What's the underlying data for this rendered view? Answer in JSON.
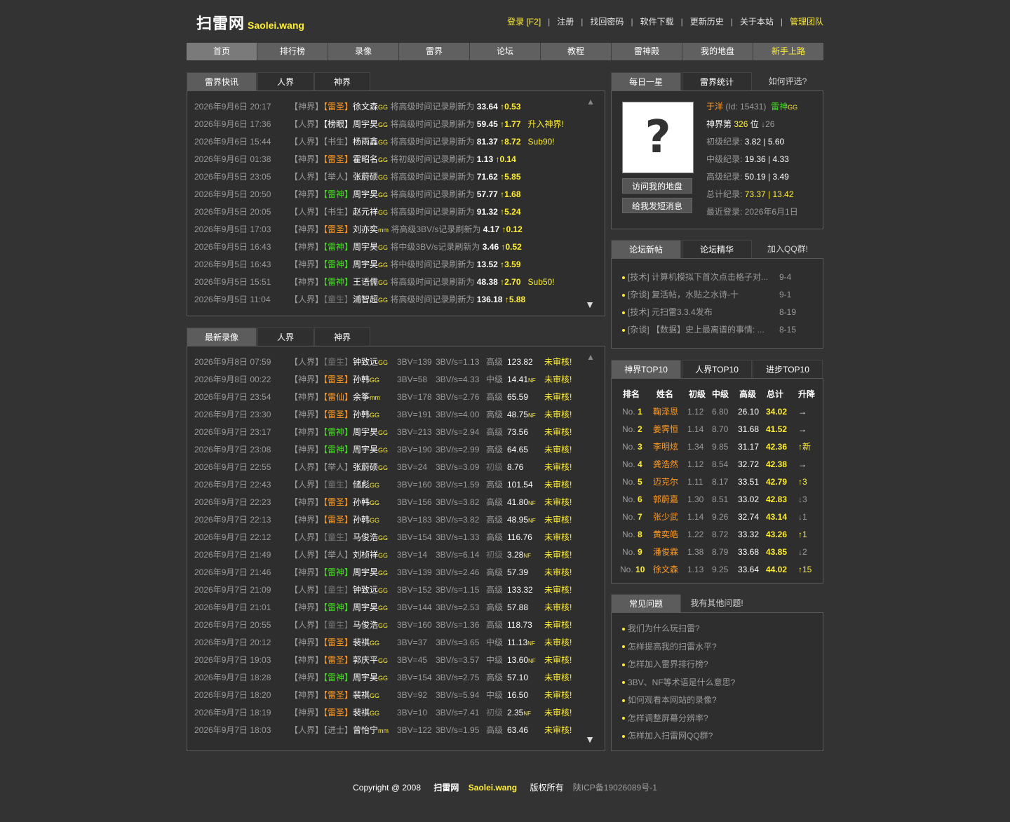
{
  "header": {
    "logo_cn": "扫雷网",
    "logo_en": "Saolei.wang",
    "links": [
      "登录 [F2]",
      "注册",
      "找回密码",
      "软件下载",
      "更新历史",
      "关于本站",
      "管理团队"
    ]
  },
  "nav": [
    "首页",
    "排行榜",
    "录像",
    "雷界",
    "论坛",
    "教程",
    "雷神殿",
    "我的地盘",
    "新手上路"
  ],
  "news": {
    "tabs": [
      "雷界快讯",
      "人界",
      "神界"
    ],
    "rows": [
      {
        "time": "2026年9月6日 20:17",
        "realm": "【神界】",
        "rank": "【雷圣】",
        "rankc": "or",
        "name": "徐文森",
        "suf": "GG",
        "msg": "将高级时间记录刷新为",
        "val": "33.64",
        "delta": "↑0.53",
        "extra": ""
      },
      {
        "time": "2026年9月6日 17:36",
        "realm": "【人界】",
        "rank": "【榜眼】",
        "rankc": "wh",
        "name": "周宇昊",
        "suf": "GG",
        "msg": "将高级时间记录刷新为",
        "val": "59.45",
        "delta": "↑1.77",
        "extra": "升入神界!"
      },
      {
        "time": "2026年9月6日 15:44",
        "realm": "【人界】",
        "rank": "【书生】",
        "rankc": "gr",
        "name": "杨雨鑫",
        "suf": "GG",
        "msg": "将高级时间记录刷新为",
        "val": "81.37",
        "delta": "↑8.72",
        "extra": "Sub90!"
      },
      {
        "time": "2026年9月6日 01:38",
        "realm": "【神界】",
        "rank": "【雷圣】",
        "rankc": "or",
        "name": "霍昭名",
        "suf": "GG",
        "msg": "将初级时间记录刷新为",
        "val": "1.13",
        "delta": "↑0.14",
        "extra": ""
      },
      {
        "time": "2026年9月5日 23:05",
        "realm": "【人界】",
        "rank": "【举人】",
        "rankc": "gr",
        "name": "张蔚硕",
        "suf": "GG",
        "msg": "将高级时间记录刷新为",
        "val": "71.62",
        "delta": "↑5.85",
        "extra": ""
      },
      {
        "time": "2026年9月5日 20:50",
        "realm": "【神界】",
        "rank": "【雷神】",
        "rankc": "gn",
        "name": "周宇昊",
        "suf": "GG",
        "msg": "将高级时间记录刷新为",
        "val": "57.77",
        "delta": "↑1.68",
        "extra": ""
      },
      {
        "time": "2026年9月5日 20:05",
        "realm": "【人界】",
        "rank": "【书生】",
        "rankc": "gr",
        "name": "赵元祥",
        "suf": "GG",
        "msg": "将高级时间记录刷新为",
        "val": "91.32",
        "delta": "↑5.24",
        "extra": ""
      },
      {
        "time": "2026年9月5日 17:03",
        "realm": "【神界】",
        "rank": "【雷圣】",
        "rankc": "or",
        "name": "刘亦奕",
        "suf": "mm",
        "msg": "将高级3BV/s记录刷新为",
        "val": "4.17",
        "delta": "↑0.12",
        "extra": ""
      },
      {
        "time": "2026年9月5日 16:43",
        "realm": "【神界】",
        "rank": "【雷神】",
        "rankc": "gn",
        "name": "周宇昊",
        "suf": "GG",
        "msg": "将中级3BV/s记录刷新为",
        "val": "3.46",
        "delta": "↑0.52",
        "extra": ""
      },
      {
        "time": "2026年9月5日 16:43",
        "realm": "【神界】",
        "rank": "【雷神】",
        "rankc": "gn",
        "name": "周宇昊",
        "suf": "GG",
        "msg": "将中级时间记录刷新为",
        "val": "13.52",
        "delta": "↑3.59",
        "extra": ""
      },
      {
        "time": "2026年9月5日 15:51",
        "realm": "【神界】",
        "rank": "【雷神】",
        "rankc": "gn",
        "name": "王语儒",
        "suf": "GG",
        "msg": "将高级时间记录刷新为",
        "val": "48.38",
        "delta": "↑2.70",
        "extra": "Sub50!"
      },
      {
        "time": "2026年9月5日 11:04",
        "realm": "【人界】",
        "rank": "【童生】",
        "rankc": "dg",
        "name": "浦智超",
        "suf": "GG",
        "msg": "将高级时间记录刷新为",
        "val": "136.18",
        "delta": "↑5.88",
        "extra": ""
      }
    ]
  },
  "videos": {
    "tabs": [
      "最新录像",
      "人界",
      "神界"
    ],
    "rows": [
      {
        "time": "2026年9月8日 07:59",
        "realm": "【人界】",
        "rank": "【童生】",
        "rankc": "dg",
        "name": "钟致远",
        "suf": "GG",
        "bv": "3BV=139",
        "bvs": "3BV/s=1.13",
        "lv": "高级",
        "val": "123.82",
        "nf": "",
        "status": "未审核!"
      },
      {
        "time": "2026年9月8日 00:22",
        "realm": "【神界】",
        "rank": "【雷圣】",
        "rankc": "or",
        "name": "孙韩",
        "suf": "GG",
        "bv": "3BV=58",
        "bvs": "3BV/s=4.33",
        "lv": "中级",
        "val": "14.41",
        "nf": "NF",
        "status": "未审核!"
      },
      {
        "time": "2026年9月7日 23:54",
        "realm": "【神界】",
        "rank": "【雷仙】",
        "rankc": "or",
        "name": "余筝",
        "suf": "mm",
        "bv": "3BV=178",
        "bvs": "3BV/s=2.76",
        "lv": "高级",
        "val": "65.59",
        "nf": "",
        "status": "未审核!"
      },
      {
        "time": "2026年9月7日 23:30",
        "realm": "【神界】",
        "rank": "【雷圣】",
        "rankc": "or",
        "name": "孙韩",
        "suf": "GG",
        "bv": "3BV=191",
        "bvs": "3BV/s=4.00",
        "lv": "高级",
        "val": "48.75",
        "nf": "NF",
        "status": "未审核!"
      },
      {
        "time": "2026年9月7日 23:17",
        "realm": "【神界】",
        "rank": "【雷神】",
        "rankc": "gn",
        "name": "周宇昊",
        "suf": "GG",
        "bv": "3BV=213",
        "bvs": "3BV/s=2.94",
        "lv": "高级",
        "val": "73.56",
        "nf": "",
        "status": "未审核!"
      },
      {
        "time": "2026年9月7日 23:08",
        "realm": "【神界】",
        "rank": "【雷神】",
        "rankc": "gn",
        "name": "周宇昊",
        "suf": "GG",
        "bv": "3BV=190",
        "bvs": "3BV/s=2.99",
        "lv": "高级",
        "val": "64.65",
        "nf": "",
        "status": "未审核!"
      },
      {
        "time": "2026年9月7日 22:55",
        "realm": "【人界】",
        "rank": "【举人】",
        "rankc": "gr",
        "name": "张蔚硕",
        "suf": "GG",
        "bv": "3BV=24",
        "bvs": "3BV/s=3.09",
        "lv": "初级",
        "val": "8.76",
        "nf": "",
        "status": "未审核!"
      },
      {
        "time": "2026年9月7日 22:43",
        "realm": "【人界】",
        "rank": "【童生】",
        "rankc": "dg",
        "name": "储彪",
        "suf": "GG",
        "bv": "3BV=160",
        "bvs": "3BV/s=1.59",
        "lv": "高级",
        "val": "101.54",
        "nf": "",
        "status": "未审核!"
      },
      {
        "time": "2026年9月7日 22:23",
        "realm": "【神界】",
        "rank": "【雷圣】",
        "rankc": "or",
        "name": "孙韩",
        "suf": "GG",
        "bv": "3BV=156",
        "bvs": "3BV/s=3.82",
        "lv": "高级",
        "val": "41.80",
        "nf": "NF",
        "status": "未审核!"
      },
      {
        "time": "2026年9月7日 22:13",
        "realm": "【神界】",
        "rank": "【雷圣】",
        "rankc": "or",
        "name": "孙韩",
        "suf": "GG",
        "bv": "3BV=183",
        "bvs": "3BV/s=3.82",
        "lv": "高级",
        "val": "48.95",
        "nf": "NF",
        "status": "未审核!"
      },
      {
        "time": "2026年9月7日 22:12",
        "realm": "【人界】",
        "rank": "【童生】",
        "rankc": "dg",
        "name": "马俊浩",
        "suf": "GG",
        "bv": "3BV=154",
        "bvs": "3BV/s=1.33",
        "lv": "高级",
        "val": "116.76",
        "nf": "",
        "status": "未审核!"
      },
      {
        "time": "2026年9月7日 21:49",
        "realm": "【人界】",
        "rank": "【举人】",
        "rankc": "gr",
        "name": "刘桢祥",
        "suf": "GG",
        "bv": "3BV=14",
        "bvs": "3BV/s=6.14",
        "lv": "初级",
        "val": "3.28",
        "nf": "NF",
        "status": "未审核!"
      },
      {
        "time": "2026年9月7日 21:46",
        "realm": "【神界】",
        "rank": "【雷神】",
        "rankc": "gn",
        "name": "周宇昊",
        "suf": "GG",
        "bv": "3BV=139",
        "bvs": "3BV/s=2.46",
        "lv": "高级",
        "val": "57.39",
        "nf": "",
        "status": "未审核!"
      },
      {
        "time": "2026年9月7日 21:09",
        "realm": "【人界】",
        "rank": "【童生】",
        "rankc": "dg",
        "name": "钟致远",
        "suf": "GG",
        "bv": "3BV=152",
        "bvs": "3BV/s=1.15",
        "lv": "高级",
        "val": "133.32",
        "nf": "",
        "status": "未审核!"
      },
      {
        "time": "2026年9月7日 21:01",
        "realm": "【神界】",
        "rank": "【雷神】",
        "rankc": "gn",
        "name": "周宇昊",
        "suf": "GG",
        "bv": "3BV=144",
        "bvs": "3BV/s=2.53",
        "lv": "高级",
        "val": "57.88",
        "nf": "",
        "status": "未审核!"
      },
      {
        "time": "2026年9月7日 20:55",
        "realm": "【人界】",
        "rank": "【童生】",
        "rankc": "dg",
        "name": "马俊浩",
        "suf": "GG",
        "bv": "3BV=160",
        "bvs": "3BV/s=1.36",
        "lv": "高级",
        "val": "118.73",
        "nf": "",
        "status": "未审核!"
      },
      {
        "time": "2026年9月7日 20:12",
        "realm": "【神界】",
        "rank": "【雷圣】",
        "rankc": "or",
        "name": "裴祺",
        "suf": "GG",
        "bv": "3BV=37",
        "bvs": "3BV/s=3.65",
        "lv": "中级",
        "val": "11.13",
        "nf": "NF",
        "status": "未审核!"
      },
      {
        "time": "2026年9月7日 19:03",
        "realm": "【神界】",
        "rank": "【雷圣】",
        "rankc": "or",
        "name": "郭庆平",
        "suf": "GG",
        "bv": "3BV=45",
        "bvs": "3BV/s=3.57",
        "lv": "中级",
        "val": "13.60",
        "nf": "NF",
        "status": "未审核!"
      },
      {
        "time": "2026年9月7日 18:28",
        "realm": "【神界】",
        "rank": "【雷神】",
        "rankc": "gn",
        "name": "周宇昊",
        "suf": "GG",
        "bv": "3BV=154",
        "bvs": "3BV/s=2.75",
        "lv": "高级",
        "val": "57.10",
        "nf": "",
        "status": "未审核!"
      },
      {
        "time": "2026年9月7日 18:20",
        "realm": "【神界】",
        "rank": "【雷圣】",
        "rankc": "or",
        "name": "裴祺",
        "suf": "GG",
        "bv": "3BV=92",
        "bvs": "3BV/s=5.94",
        "lv": "中级",
        "val": "16.50",
        "nf": "",
        "status": "未审核!"
      },
      {
        "time": "2026年9月7日 18:19",
        "realm": "【神界】",
        "rank": "【雷圣】",
        "rankc": "or",
        "name": "裴祺",
        "suf": "GG",
        "bv": "3BV=10",
        "bvs": "3BV/s=7.41",
        "lv": "初级",
        "val": "2.35",
        "nf": "NF",
        "status": "未审核!"
      },
      {
        "time": "2026年9月7日 18:03",
        "realm": "【人界】",
        "rank": "【进士】",
        "rankc": "gr",
        "name": "曾怡宁",
        "suf": "mm",
        "bv": "3BV=122",
        "bvs": "3BV/s=1.95",
        "lv": "高级",
        "val": "63.46",
        "nf": "",
        "status": "未审核!"
      }
    ]
  },
  "star": {
    "tabs": [
      "每日一星",
      "雷界统计",
      "如何评选?"
    ],
    "avatar": "?",
    "btn_visit": "访问我的地盘",
    "btn_msg": "给我发短消息",
    "name": "于洋",
    "id": "(Id: 15431)",
    "rank": "雷神",
    "suf": "GG",
    "pos_label": "神界第",
    "pos_val": "326",
    "pos_unit": "位",
    "pos_delta": "↓26",
    "lines": [
      {
        "label": "初级纪录:",
        "val": "3.82 | 5.60",
        "c": "wh"
      },
      {
        "label": "中级纪录:",
        "val": "19.36 | 4.33",
        "c": "wh"
      },
      {
        "label": "高级纪录:",
        "val": "50.19 | 3.49",
        "c": "wh"
      },
      {
        "label": "总计纪录:",
        "val": "73.37 | 13.42",
        "c": "yl"
      },
      {
        "label": "最近登录:",
        "val": "2026年6月1日",
        "c": "gr"
      }
    ]
  },
  "forum": {
    "tabs": [
      "论坛新帖",
      "论坛精华",
      "加入QQ群!"
    ],
    "items": [
      {
        "text": "[技术] 计算机模拟下首次点击格子对...",
        "date": "9-4"
      },
      {
        "text": "[杂谈] 复活帖，水贴之水诗-十",
        "date": "9-1"
      },
      {
        "text": "[技术] 元扫雷3.3.4发布",
        "date": "8-19"
      },
      {
        "text": "[杂谈] 【数据】史上最离谱的事情: ...",
        "date": "8-15"
      }
    ]
  },
  "top": {
    "tabs": [
      "神界TOP10",
      "人界TOP10",
      "进步TOP10"
    ],
    "headers": [
      "排名",
      "姓名",
      "初级",
      "中级",
      "高级",
      "总计",
      "升降"
    ],
    "rows": [
      {
        "no": "No.",
        "n": "1",
        "name": "鞠泽恩",
        "b": "1.12",
        "m": "6.80",
        "e": "26.10",
        "t": "34.02",
        "d": "→"
      },
      {
        "no": "No.",
        "n": "2",
        "name": "姜霁恒",
        "b": "1.14",
        "m": "8.70",
        "e": "31.68",
        "t": "41.52",
        "d": "→"
      },
      {
        "no": "No.",
        "n": "3",
        "name": "李明炫",
        "b": "1.34",
        "m": "9.85",
        "e": "31.17",
        "t": "42.36",
        "d": "↑新"
      },
      {
        "no": "No.",
        "n": "4",
        "name": "龚浩然",
        "b": "1.12",
        "m": "8.54",
        "e": "32.72",
        "t": "42.38",
        "d": "→"
      },
      {
        "no": "No.",
        "n": "5",
        "name": "迈克尔",
        "b": "1.11",
        "m": "8.17",
        "e": "33.51",
        "t": "42.79",
        "d": "↑3"
      },
      {
        "no": "No.",
        "n": "6",
        "name": "郭蔚嘉",
        "b": "1.30",
        "m": "8.51",
        "e": "33.02",
        "t": "42.83",
        "d": "↓3"
      },
      {
        "no": "No.",
        "n": "7",
        "name": "张少武",
        "b": "1.14",
        "m": "9.26",
        "e": "32.74",
        "t": "43.14",
        "d": "↓1"
      },
      {
        "no": "No.",
        "n": "8",
        "name": "黄奕皓",
        "b": "1.22",
        "m": "8.72",
        "e": "33.32",
        "t": "43.26",
        "d": "↑1"
      },
      {
        "no": "No.",
        "n": "9",
        "name": "潘俊霖",
        "b": "1.38",
        "m": "8.79",
        "e": "33.68",
        "t": "43.85",
        "d": "↓2"
      },
      {
        "no": "No.",
        "n": "10",
        "name": "徐文森",
        "b": "1.13",
        "m": "9.25",
        "e": "33.64",
        "t": "44.02",
        "d": "↑15"
      }
    ]
  },
  "faq": {
    "tabs": [
      "常见问题",
      "我有其他问题!"
    ],
    "items": [
      "我们为什么玩扫雷?",
      "怎样提高我的扫雷水平?",
      "怎样加入雷界排行榜?",
      "3BV、NF等术语是什么意思?",
      "如何观看本网站的录像?",
      "怎样调整屏幕分辨率?",
      "怎样加入扫雷网QQ群?"
    ]
  },
  "footer": {
    "copy": "Copyright @ 2008",
    "site_cn": "扫雷网",
    "site_en": "Saolei.wang",
    "rights": "版权所有",
    "icp": "陕ICP备19026089号-1"
  },
  "scroll": {
    "up": "▲",
    "down": "▼"
  }
}
